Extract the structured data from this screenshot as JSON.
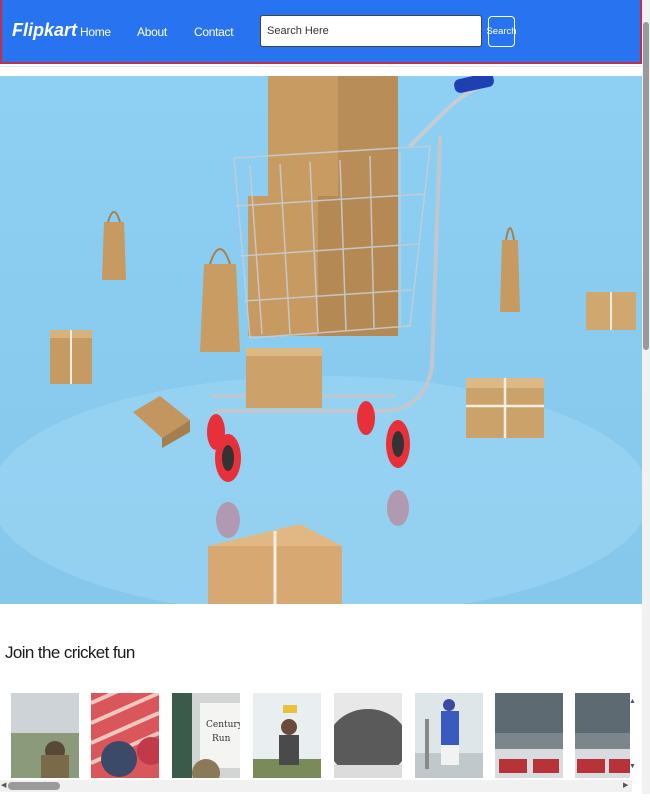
{
  "nav": {
    "brand": "Flipkart",
    "links": [
      "Home",
      "About",
      "Contact"
    ],
    "search_placeholder": "Search Here",
    "search_button": "Search"
  },
  "section": {
    "title": "Join the cricket fun"
  },
  "icons": [
    "cart-icon",
    "scroll-up-arrow-icon",
    "scroll-down-arrow-icon",
    "scroll-left-arrow-icon",
    "scroll-right-arrow-icon"
  ],
  "colors": {
    "nav_bg": "#2874f0",
    "nav_border": "#c0304a",
    "hero_bg": "#8ccdf0"
  }
}
